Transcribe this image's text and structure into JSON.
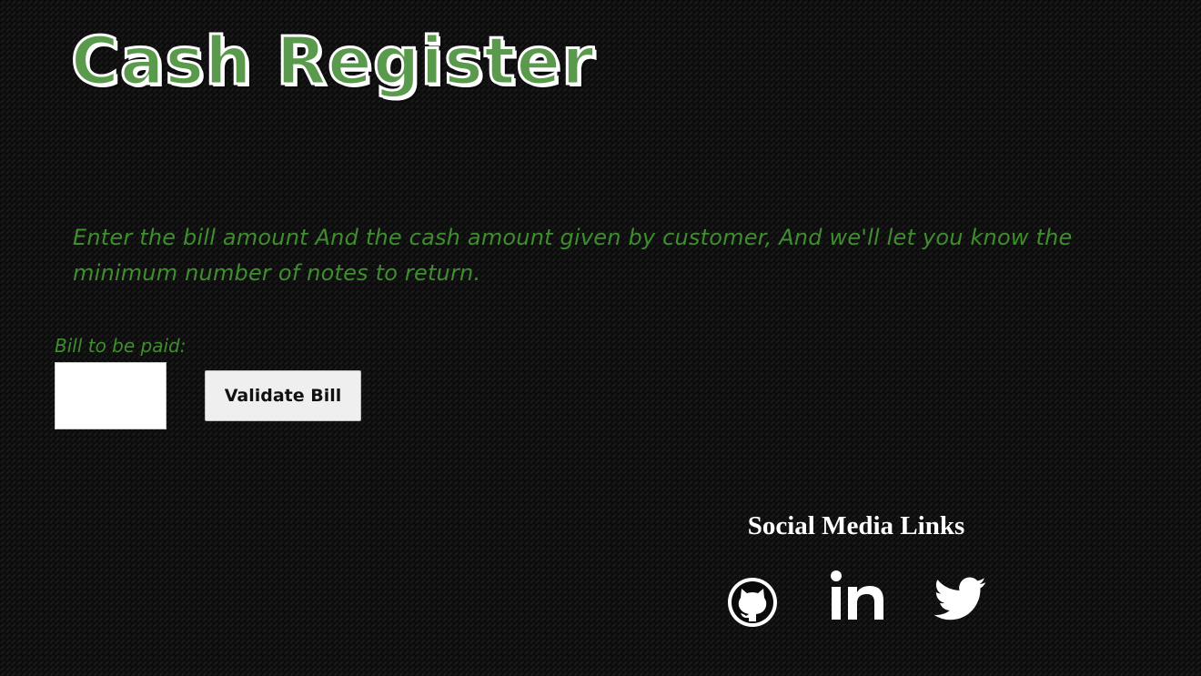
{
  "header": {
    "title": "Cash Register"
  },
  "intro": {
    "text": "Enter the bill amount And the cash amount given by customer, And we'll let you know the minimum number of notes to return."
  },
  "form": {
    "bill_label": "Bill to be paid:",
    "bill_value": "",
    "validate_button_label": "Validate Bill"
  },
  "footer": {
    "heading": "Social Media Links",
    "links": [
      {
        "icon": "github-icon"
      },
      {
        "icon": "linkedin-icon"
      },
      {
        "icon": "twitter-icon"
      }
    ]
  },
  "colors": {
    "background": "#0a0a0a",
    "title_fill": "#5a9a4c",
    "text_green": "#3e8e2e",
    "white": "#ffffff"
  }
}
